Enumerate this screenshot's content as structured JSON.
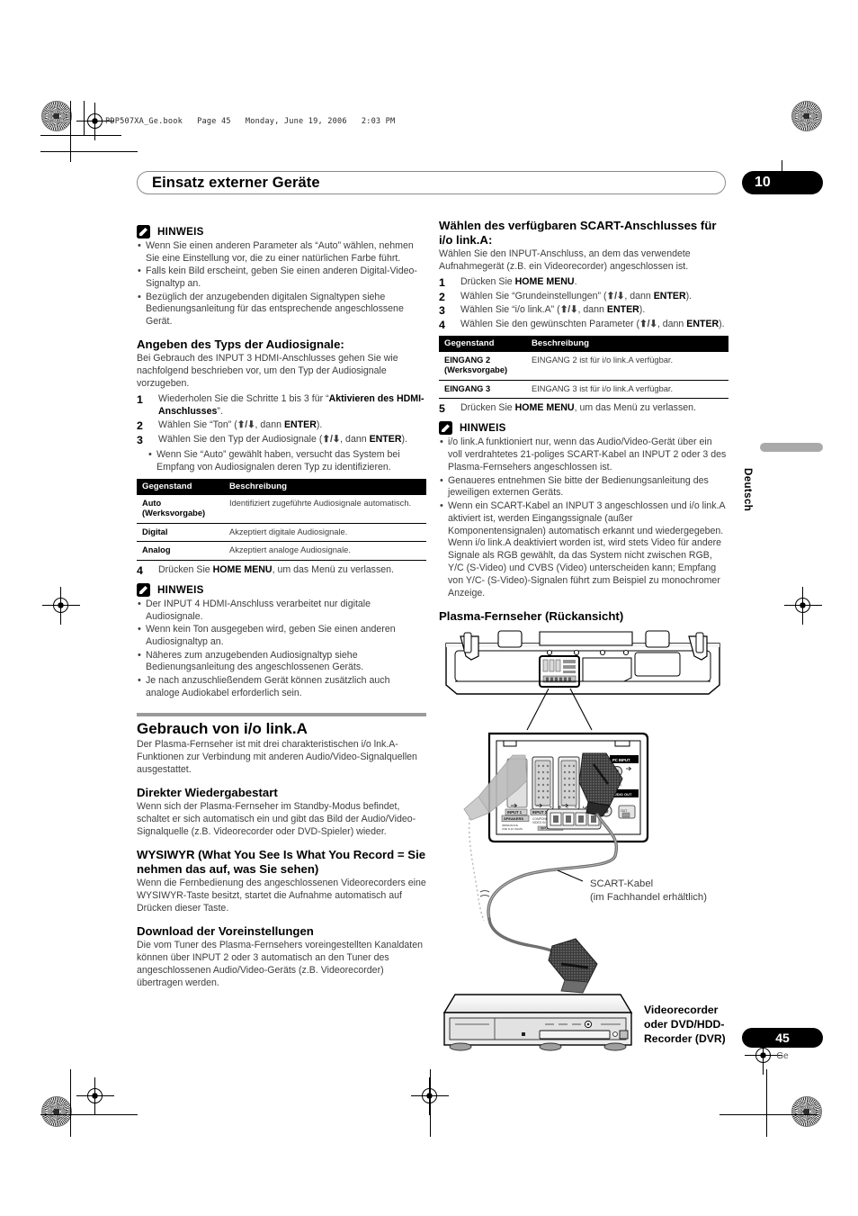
{
  "print_marks": {
    "file_header": "PDP507XA_Ge.book   Page 45   Monday, June 19, 2006   2:03 PM"
  },
  "header": {
    "chapter_title": "Einsatz externer Geräte",
    "chapter_number": "10"
  },
  "side_tab": {
    "language": "Deutsch"
  },
  "footer": {
    "page_number": "45",
    "language_code": "Ge"
  },
  "left_column": {
    "note1": {
      "title": "HINWEIS",
      "bullets": [
        "Wenn Sie einen anderen Parameter als “Auto” wählen, nehmen Sie eine Einstellung vor, die zu einer natürlichen Farbe führt.",
        "Falls kein Bild erscheint, geben Sie einen anderen Digital-Video-Signaltyp an.",
        "Bezüglich der anzugebenden digitalen Signaltypen siehe Bedienungsanleitung für das entsprechende angeschlossene Gerät."
      ]
    },
    "audio_section": {
      "heading": "Angeben des Typs der Audiosignale:",
      "intro": "Bei Gebrauch des INPUT 3 HDMI-Anschlusses gehen Sie wie nachfolgend beschrieben vor, um den Typ der Audiosignale vorzugeben.",
      "steps": [
        {
          "num": "1",
          "text_a": "Wiederholen Sie die Schritte 1 bis 3 für “",
          "bold_a": "Aktivieren des HDMI-Anschlusses",
          "text_b": "”."
        },
        {
          "num": "2",
          "text_a": "Wählen Sie “Ton” (",
          "arrows": "⬆/⬇",
          "text_b": ", dann ",
          "bold_b": "ENTER",
          "text_c": ")."
        },
        {
          "num": "3",
          "text_a": "Wählen Sie den Typ der Audiosignale (",
          "arrows": "⬆/⬇",
          "text_b": ", dann ",
          "bold_b": "ENTER",
          "text_c": ")."
        }
      ],
      "substep": "Wenn Sie “Auto” gewählt haben, versucht das System bei Empfang von Audiosignalen deren Typ zu identifizieren.",
      "table": {
        "columns": [
          "Gegenstand",
          "Beschreibung"
        ],
        "rows": [
          {
            "item": "Auto (Werksvorgabe)",
            "desc": "Identifiziert zugeführte Audiosignale automatisch."
          },
          {
            "item": "Digital",
            "desc": "Akzeptiert digitale Audiosignale."
          },
          {
            "item": "Analog",
            "desc": "Akzeptiert analoge Audiosignale."
          }
        ]
      },
      "step4": {
        "num": "4",
        "text_a": "Drücken Sie ",
        "bold_a": "HOME MENU",
        "text_b": ", um das Menü zu verlassen."
      }
    },
    "note2": {
      "title": "HINWEIS",
      "bullets": [
        "Der INPUT 4 HDMI-Anschluss verarbeitet nur digitale Audiosignale.",
        "Wenn kein Ton ausgegeben wird, geben Sie einen anderen Audiosignaltyp an.",
        "Näheres zum anzugebenden Audiosignaltyp siehe Bedienungsanleitung des angeschlossenen Geräts.",
        "Je nach anzuschließendem Gerät können zusätzlich auch analoge Audiokabel erforderlich sein."
      ]
    },
    "iolink_section": {
      "heading": "Gebrauch von i/o link.A",
      "intro": "Der Plasma-Fernseher ist mit drei charakteristischen i/o lnk.A-Funktionen zur Verbindung mit anderen Audio/Video-Signalquellen ausgestattet.",
      "sub1_heading": "Direkter Wiedergabestart",
      "sub1_text": "Wenn sich der Plasma-Fernseher im Standby-Modus befindet, schaltet er sich automatisch ein und gibt das Bild der Audio/Video-Signalquelle (z.B. Videorecorder oder DVD-Spieler) wieder.",
      "sub2_heading": "WYSIWYR (What You See Is What You Record = Sie nehmen das auf, was Sie sehen)",
      "sub2_text": "Wenn die Fernbedienung des angeschlossenen Videorecorders eine WYSIWYR-Taste besitzt, startet die Aufnahme automatisch auf Drücken dieser Taste.",
      "sub3_heading": "Download der Voreinstellungen",
      "sub3_text": "Die vom Tuner des Plasma-Fernsehers voreingestellten Kanaldaten können über INPUT 2 oder 3 automatisch an den Tuner des angeschlossenen Audio/Video-Geräts (z.B. Videorecorder) übertragen werden."
    }
  },
  "right_column": {
    "scart_section": {
      "heading": "Wählen des verfügbaren SCART-Anschlusses für i/o link.A:",
      "intro": "Wählen Sie den INPUT-Anschluss, an dem das verwendete Aufnahmegerät (z.B. ein Videorecorder) angeschlossen ist.",
      "steps": [
        {
          "num": "1",
          "text_a": "Drücken Sie ",
          "bold_a": "HOME MENU",
          "text_b": "."
        },
        {
          "num": "2",
          "text_a": "Wählen Sie “Grundeinstellungen” (",
          "arrows": "⬆/⬇",
          "text_b": ", dann ",
          "bold_b": "ENTER",
          "text_c": ")."
        },
        {
          "num": "3",
          "text_a": "Wählen Sie “i/o link.A” (",
          "arrows": "⬆/⬇",
          "text_b": ", dann ",
          "bold_b": "ENTER",
          "text_c": ")."
        },
        {
          "num": "4",
          "text_a": "Wählen Sie den gewünschten Parameter (",
          "arrows": "⬆/⬇",
          "text_b": ", dann ",
          "bold_b": "ENTER",
          "text_c": ")."
        }
      ],
      "table": {
        "columns": [
          "Gegenstand",
          "Beschreibung"
        ],
        "rows": [
          {
            "item": "EINGANG 2 (Werksvorgabe)",
            "desc": "EINGANG 2 ist für i/o link.A verfügbar."
          },
          {
            "item": "EINGANG 3",
            "desc": "EINGANG 3 ist für i/o link.A verfügbar."
          }
        ]
      },
      "step5": {
        "num": "5",
        "text_a": "Drücken Sie ",
        "bold_a": "HOME MENU",
        "text_b": ", um das Menü zu verlassen."
      }
    },
    "note3": {
      "title": "HINWEIS",
      "bullets": [
        "i/o link.A funktioniert nur, wenn das Audio/Video-Gerät über ein voll verdrahtetes 21-poliges SCART-Kabel an INPUT 2 oder 3 des Plasma-Fernsehers angeschlossen ist.",
        "Genaueres entnehmen Sie bitte der Bedienungsanleitung des jeweiligen externen Geräts.",
        "Wenn ein SCART-Kabel an INPUT 3 angeschlossen und i/o link.A aktiviert ist, werden Eingangssignale (außer Komponentensignalen) automatisch erkannt und wiedergegeben. Wenn i/o link.A deaktiviert worden ist, wird stets Video für andere Signale als RGB gewählt, da das System nicht zwischen RGB, Y/C (S-Video) und CVBS (Video) unterscheiden kann; Empfang von Y/C- (S-Video)-Signalen führt zum Beispiel zu monochromer Anzeige."
      ]
    },
    "figure": {
      "caption": "Plasma-Fernseher (Rückansicht)",
      "cable_label_line1": "SCART-Kabel",
      "cable_label_line2": "(im Fachhandel erhältlich)",
      "device_label_line1": "Videorecorder",
      "device_label_line2": "oder DVD/HDD-",
      "device_label_line3": "Recorder (DVR)",
      "port_labels": [
        "INPUT 1",
        "INPUT 2",
        "INPUT 3",
        "PC INPUT",
        "AUDIO OUT",
        "SPEAKERS"
      ]
    }
  }
}
